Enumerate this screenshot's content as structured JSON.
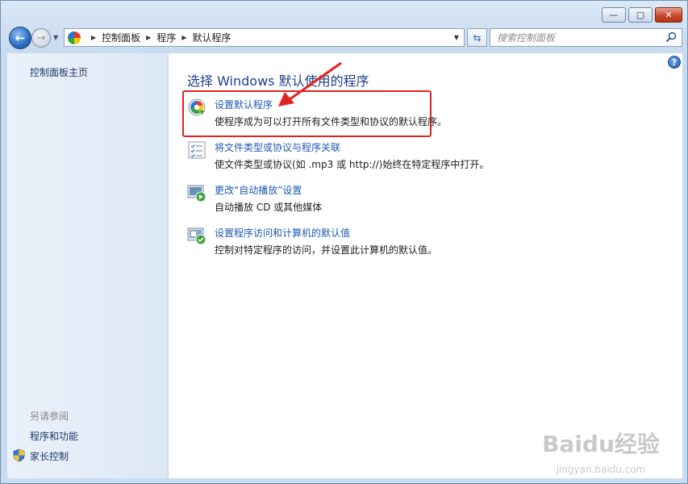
{
  "window": {
    "caption": {
      "minimize": "—",
      "maximize": "▢",
      "close": "✕"
    }
  },
  "toolbar": {
    "breadcrumbs": [
      "控制面板",
      "程序",
      "默认程序"
    ],
    "search_placeholder": "搜索控制面板"
  },
  "sidebar": {
    "home_link": "控制面板主页",
    "see_also_label": "另请参阅",
    "see_also_items": [
      "程序和功能",
      "家长控制"
    ]
  },
  "main": {
    "title": "选择 Windows 默认使用的程序",
    "help": "?",
    "tasks": [
      {
        "link": "设置默认程序",
        "desc": "使程序成为可以打开所有文件类型和协议的默认程序。",
        "icon": "default-programs-icon"
      },
      {
        "link": "将文件类型或协议与程序关联",
        "desc": "使文件类型或协议(如 .mp3 或 http://)始终在特定程序中打开。",
        "icon": "file-association-icon"
      },
      {
        "link": "更改“自动播放”设置",
        "desc": "自动播放 CD 或其他媒体",
        "icon": "autoplay-icon"
      },
      {
        "link": "设置程序访问和计算机的默认值",
        "desc": "控制对特定程序的访问，并设置此计算机的默认值。",
        "icon": "program-access-icon"
      }
    ]
  },
  "watermark": {
    "brand": "Baidu经验",
    "url": "jingyan.baidu.com"
  },
  "colors": {
    "link": "#1e58b4",
    "title": "#1e3f8c",
    "highlight": "#e22222"
  }
}
